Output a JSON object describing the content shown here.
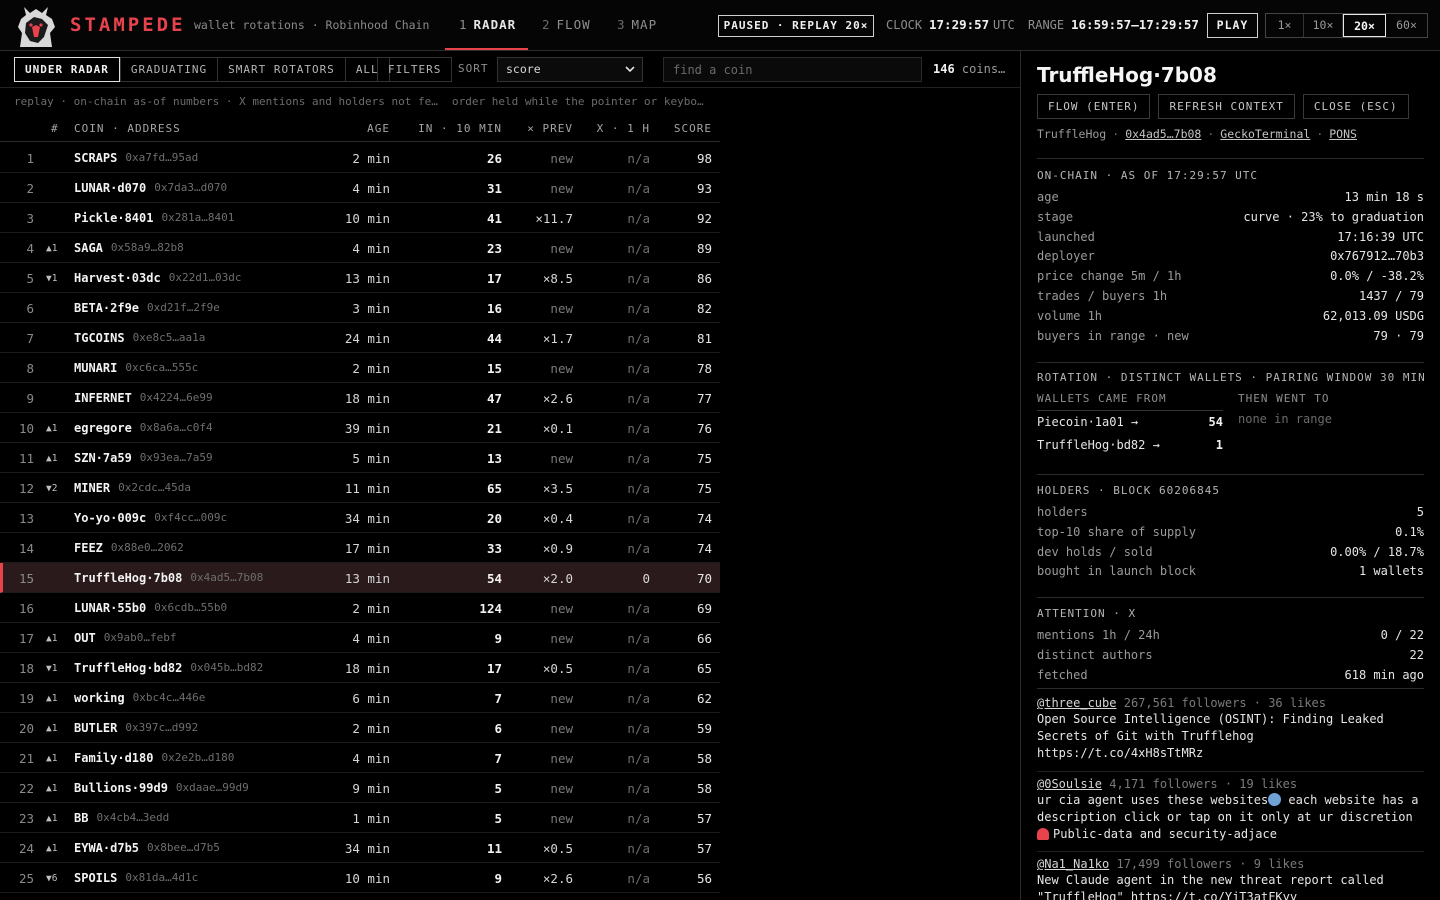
{
  "header": {
    "brand": "STAMPEDE",
    "tagline": "wallet rotations · Robinhood Chain",
    "tabs": [
      {
        "num": "1",
        "label": "RADAR"
      },
      {
        "num": "2",
        "label": "FLOW"
      },
      {
        "num": "3",
        "label": "MAP"
      }
    ],
    "status": "PAUSED · REPLAY 20×",
    "clock_label": "CLOCK",
    "clock_value": "17:29:57",
    "clock_tz": "UTC",
    "range_label": "RANGE",
    "range_value": "16:59:57–17:29:57",
    "play_label": "PLAY",
    "speeds": [
      "1×",
      "10×",
      "20×",
      "60×"
    ],
    "active_speed": "20×"
  },
  "filters": {
    "buttons": [
      "UNDER RADAR",
      "GRADUATING",
      "SMART ROTATORS",
      "ALL"
    ],
    "filters_label": "FILTERS",
    "sort_label": "SORT",
    "sort_value": "score",
    "search_placeholder": "find a coin",
    "count_value": "146",
    "count_suffix": "coins…",
    "hint_left": "replay · on-chain as-of numbers · X mentions and holders not fe…",
    "hint_right": "order held while the pointer or keybo…"
  },
  "table": {
    "headers": {
      "rank": "#",
      "coin": "COIN · ADDRESS",
      "age": "AGE",
      "in": "IN · 10 MIN",
      "prev": "× PREV",
      "x": "X · 1 H",
      "score": "SCORE"
    },
    "rows": [
      {
        "rank": "1",
        "move": "",
        "coin": "SCRAPS",
        "addr": "0xa7fd…95ad",
        "age": "2 min",
        "in": "26",
        "prev": "new",
        "x": "n/a",
        "score": "98"
      },
      {
        "rank": "2",
        "move": "",
        "coin": "LUNAR·d070",
        "addr": "0x7da3…d070",
        "age": "4 min",
        "in": "31",
        "prev": "new",
        "x": "n/a",
        "score": "93"
      },
      {
        "rank": "3",
        "move": "",
        "coin": "Pickle·8401",
        "addr": "0x281a…8401",
        "age": "10 min",
        "in": "41",
        "prev": "×11.7",
        "x": "n/a",
        "score": "92"
      },
      {
        "rank": "4",
        "move": "▲1",
        "coin": "SAGA",
        "addr": "0x58a9…82b8",
        "age": "4 min",
        "in": "23",
        "prev": "new",
        "x": "n/a",
        "score": "89"
      },
      {
        "rank": "5",
        "move": "▼1",
        "coin": "Harvest·03dc",
        "addr": "0x22d1…03dc",
        "age": "13 min",
        "in": "17",
        "prev": "×8.5",
        "x": "n/a",
        "score": "86"
      },
      {
        "rank": "6",
        "move": "",
        "coin": "BETA·2f9e",
        "addr": "0xd21f…2f9e",
        "age": "3 min",
        "in": "16",
        "prev": "new",
        "x": "n/a",
        "score": "82"
      },
      {
        "rank": "7",
        "move": "",
        "coin": "TGCOINS",
        "addr": "0xe8c5…aa1a",
        "age": "24 min",
        "in": "44",
        "prev": "×1.7",
        "x": "n/a",
        "score": "81"
      },
      {
        "rank": "8",
        "move": "",
        "coin": "MUNARI",
        "addr": "0xc6ca…555c",
        "age": "2 min",
        "in": "15",
        "prev": "new",
        "x": "n/a",
        "score": "78"
      },
      {
        "rank": "9",
        "move": "",
        "coin": "INFERNET",
        "addr": "0x4224…6e99",
        "age": "18 min",
        "in": "47",
        "prev": "×2.6",
        "x": "n/a",
        "score": "77"
      },
      {
        "rank": "10",
        "move": "▲1",
        "coin": "egregore",
        "addr": "0x8a6a…c0f4",
        "age": "39 min",
        "in": "21",
        "prev": "×0.1",
        "x": "n/a",
        "score": "76"
      },
      {
        "rank": "11",
        "move": "▲1",
        "coin": "SZN·7a59",
        "addr": "0x93ea…7a59",
        "age": "5 min",
        "in": "13",
        "prev": "new",
        "x": "n/a",
        "score": "75"
      },
      {
        "rank": "12",
        "move": "▼2",
        "coin": "MINER",
        "addr": "0x2cdc…45da",
        "age": "11 min",
        "in": "65",
        "prev": "×3.5",
        "x": "n/a",
        "score": "75"
      },
      {
        "rank": "13",
        "move": "",
        "coin": "Yo-yo·009c",
        "addr": "0xf4cc…009c",
        "age": "34 min",
        "in": "20",
        "prev": "×0.4",
        "x": "n/a",
        "score": "74"
      },
      {
        "rank": "14",
        "move": "",
        "coin": "FEEZ",
        "addr": "0x88e0…2062",
        "age": "17 min",
        "in": "33",
        "prev": "×0.9",
        "x": "n/a",
        "score": "74"
      },
      {
        "rank": "15",
        "move": "",
        "coin": "TruffleHog·7b08",
        "addr": "0x4ad5…7b08",
        "age": "13 min",
        "in": "54",
        "prev": "×2.0",
        "x": "0",
        "score": "70",
        "selected": true
      },
      {
        "rank": "16",
        "move": "",
        "coin": "LUNAR·55b0",
        "addr": "0x6cdb…55b0",
        "age": "2 min",
        "in": "124",
        "prev": "new",
        "x": "n/a",
        "score": "69"
      },
      {
        "rank": "17",
        "move": "▲1",
        "coin": "OUT",
        "addr": "0x9ab0…febf",
        "age": "4 min",
        "in": "9",
        "prev": "new",
        "x": "n/a",
        "score": "66"
      },
      {
        "rank": "18",
        "move": "▼1",
        "coin": "TruffleHog·bd82",
        "addr": "0x045b…bd82",
        "age": "18 min",
        "in": "17",
        "prev": "×0.5",
        "x": "n/a",
        "score": "65"
      },
      {
        "rank": "19",
        "move": "▲1",
        "coin": "working",
        "addr": "0xbc4c…446e",
        "age": "6 min",
        "in": "7",
        "prev": "new",
        "x": "n/a",
        "score": "62"
      },
      {
        "rank": "20",
        "move": "▲1",
        "coin": "BUTLER",
        "addr": "0x397c…d992",
        "age": "2 min",
        "in": "6",
        "prev": "new",
        "x": "n/a",
        "score": "59"
      },
      {
        "rank": "21",
        "move": "▲1",
        "coin": "Family·d180",
        "addr": "0x2e2b…d180",
        "age": "4 min",
        "in": "7",
        "prev": "new",
        "x": "n/a",
        "score": "58"
      },
      {
        "rank": "22",
        "move": "▲1",
        "coin": "Bullions·99d9",
        "addr": "0xdaae…99d9",
        "age": "9 min",
        "in": "5",
        "prev": "new",
        "x": "n/a",
        "score": "58"
      },
      {
        "rank": "23",
        "move": "▲1",
        "coin": "BB",
        "addr": "0x4cb4…3edd",
        "age": "1 min",
        "in": "5",
        "prev": "new",
        "x": "n/a",
        "score": "57"
      },
      {
        "rank": "24",
        "move": "▲1",
        "coin": "EYWA·d7b5",
        "addr": "0x8bee…d7b5",
        "age": "34 min",
        "in": "11",
        "prev": "×0.5",
        "x": "n/a",
        "score": "57"
      },
      {
        "rank": "25",
        "move": "▼6",
        "coin": "SPOILS",
        "addr": "0x81da…4d1c",
        "age": "10 min",
        "in": "9",
        "prev": "×2.6",
        "x": "n/a",
        "score": "56"
      }
    ]
  },
  "detail": {
    "title": "TruffleHog·7b08",
    "buttons": [
      "FLOW (ENTER)",
      "REFRESH CONTEXT",
      "CLOSE (ESC)"
    ],
    "links": {
      "name": "TruffleHog",
      "addr": "0x4ad5…7b08",
      "gecko": "GeckoTerminal",
      "pons": "PONS"
    },
    "onchain": {
      "title": "ON-CHAIN · AS OF 17:29:57 UTC",
      "rows": [
        {
          "k": "age",
          "v": "13 min 18 s"
        },
        {
          "k": "stage",
          "v": "curve · 23% to graduation"
        },
        {
          "k": "launched",
          "v": "17:16:39 UTC"
        },
        {
          "k": "deployer",
          "v": "0x767912…70b3"
        },
        {
          "k": "price change 5m / 1h",
          "v": "0.0% / -38.2%"
        },
        {
          "k": "trades / buyers 1h",
          "v": "1437 / 79"
        },
        {
          "k": "volume 1h",
          "v": "62,013.09 USDG"
        },
        {
          "k": "buyers in range · new",
          "v": "79 · 79"
        }
      ]
    },
    "rotation": {
      "title": "ROTATION · DISTINCT WALLETS · PAIRING WINDOW 30 MIN",
      "came_from": "WALLETS CAME FROM",
      "went_to": "THEN WENT TO",
      "from_rows": [
        {
          "name": "Piecoin·1a01 →",
          "count": "54"
        },
        {
          "name": "TruffleHog·bd82 →",
          "count": "1"
        }
      ],
      "none_text": "none in range"
    },
    "holders": {
      "title": "HOLDERS · BLOCK 60206845",
      "rows": [
        {
          "k": "holders",
          "v": "5"
        },
        {
          "k": "top-10 share of supply",
          "v": "0.1%"
        },
        {
          "k": "dev holds / sold",
          "v": "0.00% / 18.7%"
        },
        {
          "k": "bought in launch block",
          "v": "1 wallets"
        }
      ]
    },
    "attention": {
      "title": "ATTENTION · X",
      "rows": [
        {
          "k": "mentions 1h / 24h",
          "v": "0 / 22"
        },
        {
          "k": "distinct authors",
          "v": "22"
        },
        {
          "k": "fetched",
          "v": "618 min ago"
        }
      ]
    },
    "posts": [
      {
        "handle": "@three_cube",
        "meta": "267,561 followers · 36 likes",
        "text": "Open Source Intelligence (OSINT): Finding Leaked Secrets of Git with Trufflehog https://t.co/4xH8sTtMRz"
      },
      {
        "handle": "@0Soulsie",
        "meta": "4,171 followers · 19 likes",
        "text_a": "ur cia agent uses these websites",
        "text_b": " each website has a description click or tap on it only at ur discretion",
        "text_c": "Public-data and security-adjace"
      },
      {
        "handle": "@Na1_Na1ko",
        "meta": "17,499 followers · 9 likes",
        "text": "New Claude agent in the new threat report called \"TruffleHog\" https://t.co/YjT3atFKyy"
      }
    ]
  }
}
